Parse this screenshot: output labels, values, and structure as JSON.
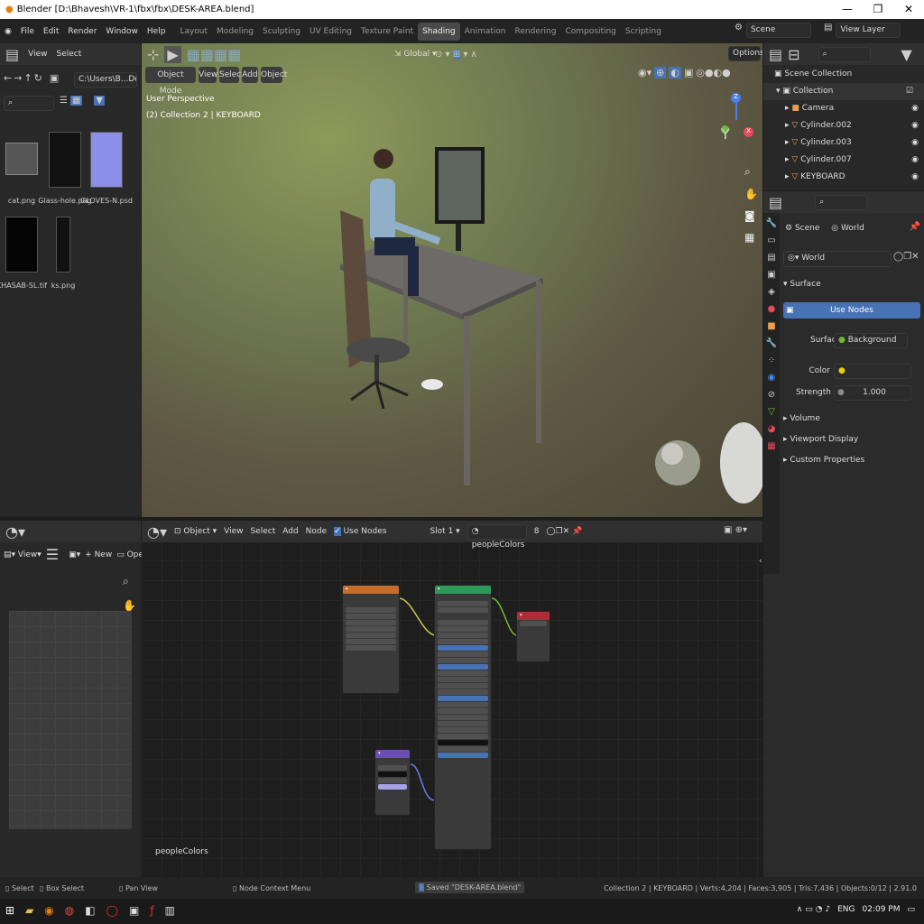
{
  "window": {
    "title": "Blender [D:\\Bhavesh\\VR-1\\fbx\\fbx\\DESK-AREA.blend]",
    "min": "—",
    "max": "❐",
    "close": "✕"
  },
  "menu": [
    "File",
    "Edit",
    "Render",
    "Window",
    "Help"
  ],
  "workspaces": [
    "Layout",
    "Modeling",
    "Sculpting",
    "UV Editing",
    "Texture Paint",
    "Shading",
    "Animation",
    "Rendering",
    "Compositing",
    "Scripting"
  ],
  "active_workspace": "Shading",
  "scene": {
    "scene_name": "Scene",
    "view_layer": "View Layer"
  },
  "filebrowser": {
    "view": "View",
    "select": "Select",
    "path": "C:\\Users\\B...Documents\\",
    "files": [
      {
        "name": "cat.png"
      },
      {
        "name": "Glass-hole.png"
      },
      {
        "name": "GLOVES-N.psd"
      },
      {
        "name": "KHASAB-SL.tif"
      },
      {
        "name": "ks.png"
      }
    ]
  },
  "viewport": {
    "transform_orientation": "Global",
    "options": "Options",
    "mode": "Object Mode",
    "menu": [
      "View",
      "Select",
      "Add",
      "Object"
    ],
    "perspective": "User Perspective",
    "collection_info": "(2) Collection 2 | KEYBOARD",
    "gizmo": {
      "z": "Z",
      "y": "Y",
      "x": "X"
    }
  },
  "outliner": {
    "rows": [
      {
        "label": "Scene Collection",
        "icon": "collection-icon"
      },
      {
        "label": "Collection",
        "icon": "collection-icon"
      },
      {
        "label": "Camera",
        "icon": "camera-icon"
      },
      {
        "label": "Cylinder.002",
        "icon": "mesh-icon"
      },
      {
        "label": "Cylinder.003",
        "icon": "mesh-icon"
      },
      {
        "label": "Cylinder.007",
        "icon": "mesh-icon"
      },
      {
        "label": "KEYBOARD",
        "icon": "mesh-icon"
      }
    ]
  },
  "properties": {
    "breadcrumb_scene": "Scene",
    "breadcrumb_world": "World",
    "world_name": "World",
    "surface_panel": "Surface",
    "use_nodes": "Use Nodes",
    "surface_label": "Surface",
    "surface_value": "Background",
    "color_label": "Color",
    "strength_label": "Strength",
    "strength_value": "1.000",
    "volume": "Volume",
    "viewport_display": "Viewport Display",
    "custom_properties": "Custom Properties"
  },
  "uv_editor": {
    "view": "View",
    "new": "New",
    "open": "Open"
  },
  "node_editor": {
    "object": "Object",
    "menu": [
      "View",
      "Select",
      "Add",
      "Node"
    ],
    "use_nodes": "Use Nodes",
    "slot": "Slot 1",
    "material": "peopleColors",
    "users": "8",
    "material_label": "peopleColors"
  },
  "status": {
    "select": "Select",
    "box_select": "Box Select",
    "pan_view": "Pan View",
    "context_menu": "Node Context Menu",
    "saved": "Saved \"DESK-AREA.blend\"",
    "stats": "Collection 2 | KEYBOARD | Verts:4,204 | Faces:3,905 | Tris:7,436 | Objects:0/12 | 2.91.0"
  },
  "taskbar": {
    "lang": "ENG",
    "time": "02:09 PM"
  }
}
